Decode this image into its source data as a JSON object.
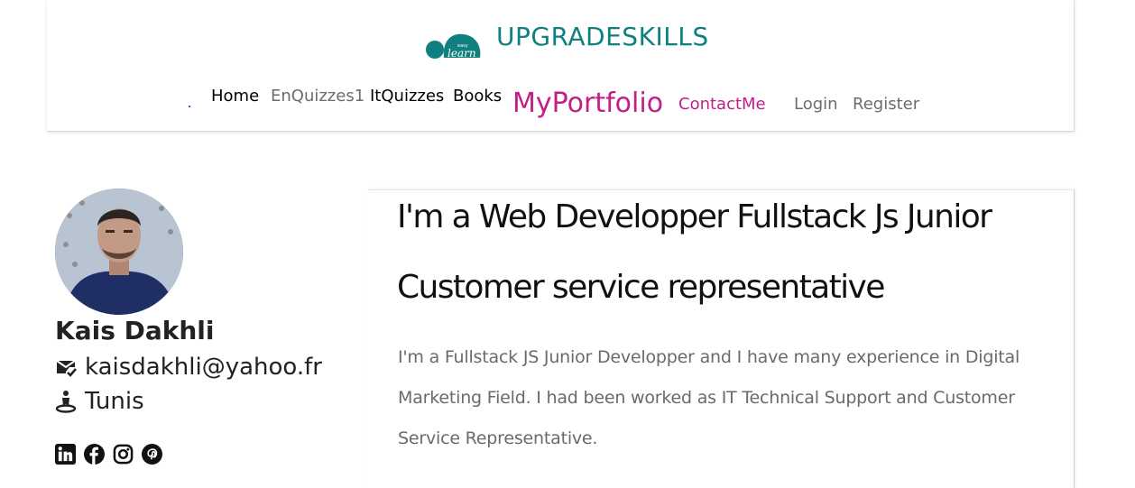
{
  "brand": {
    "name": "UPGRADESKILLS",
    "logo_text_small": "easy",
    "logo_text": "learn",
    "logo_icon": "learn-logo-icon"
  },
  "nav": {
    "home": "Home",
    "enquizzes": "EnQuizzes1",
    "itquizzes": "ItQuizzes",
    "books": "Books",
    "portfolio": "MyPortfolio",
    "contact": "ContactMe",
    "login": "Login",
    "register": "Register"
  },
  "profile": {
    "name": "Kais Dakhli",
    "email": "kaisdakhli@yahoo.fr",
    "email_icon": "mail-check-icon",
    "location": "Tunis",
    "location_icon": "location-person-icon",
    "social": [
      "linkedin-icon",
      "facebook-icon",
      "instagram-icon",
      "pinterest-icon"
    ]
  },
  "about": {
    "headline_1": "I'm a Web Developper Fullstack Js Junior",
    "headline_2": "Customer service representative",
    "bio": "I'm a Fullstack JS Junior Developper and I have many experience in Digital Marketing Field. I had been worked as IT Technical Support and Customer Service Representative."
  },
  "colors": {
    "brand_teal": "#0f7f80",
    "accent_magenta": "#c21f86",
    "muted_gray": "#6c6c6c"
  }
}
